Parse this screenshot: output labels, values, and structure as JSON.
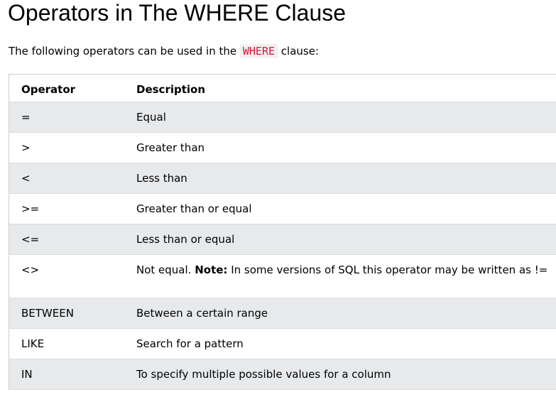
{
  "page": {
    "title": "Operators in The WHERE Clause",
    "intro_before": "The following operators can be used in the ",
    "intro_code": "WHERE",
    "intro_after": " clause:"
  },
  "table": {
    "headers": [
      "Operator",
      "Description"
    ],
    "rows": [
      {
        "operator": "=",
        "description": "Equal"
      },
      {
        "operator": ">",
        "description": "Greater than"
      },
      {
        "operator": "<",
        "description": "Less than"
      },
      {
        "operator": ">=",
        "description": "Greater than or equal"
      },
      {
        "operator": "<=",
        "description": "Less than or equal"
      },
      {
        "operator": "<>",
        "description": "Not equal.",
        "note_label": "Note:",
        "note_text": " In some versions of SQL this operator may be written as !="
      },
      {
        "operator": "BETWEEN",
        "description": "Between a certain range"
      },
      {
        "operator": "LIKE",
        "description": "Search for a pattern"
      },
      {
        "operator": "IN",
        "description": "To specify multiple possible values for a column"
      }
    ]
  },
  "colors": {
    "code_text": "#dc143c",
    "code_background": "#f1f1f1",
    "stripe": "#e7e9eb",
    "border": "#cccccc"
  }
}
